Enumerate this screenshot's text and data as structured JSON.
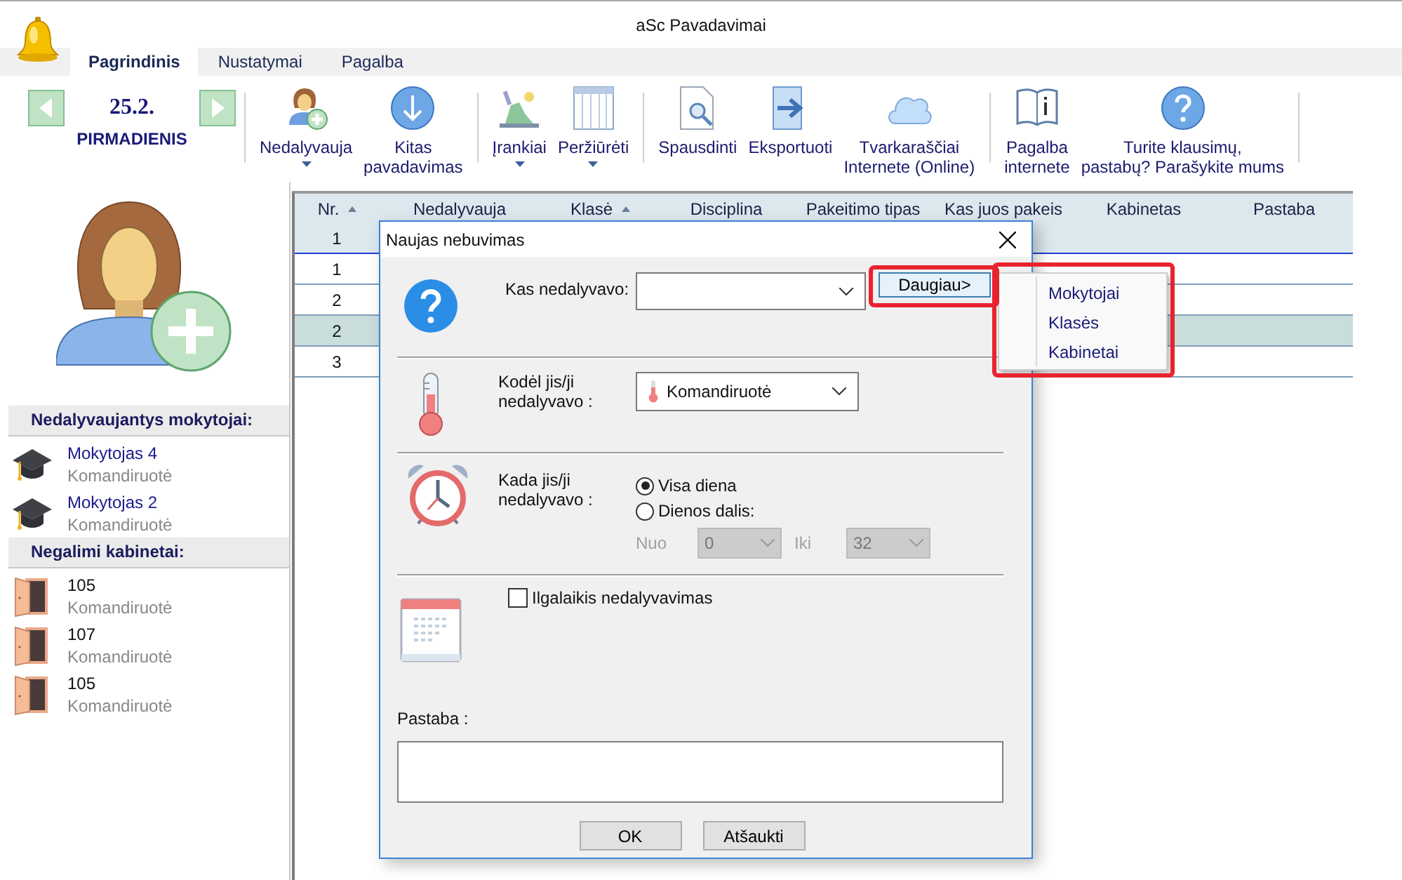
{
  "window": {
    "title": "aSc Pavadavimai"
  },
  "tabs": [
    {
      "label": "Pagrindinis",
      "selected": true
    },
    {
      "label": "Nustatymai",
      "selected": false
    },
    {
      "label": "Pagalba",
      "selected": false
    }
  ],
  "date": {
    "day": "25.2.",
    "weekday": "PIRMADIENIS"
  },
  "toolbar_groups": [
    [
      {
        "kind": "person-add",
        "label": "Nedalyvauja",
        "dropdown": true
      },
      {
        "kind": "arrow-down",
        "label": "Kitas\npavadavimas",
        "dropdown": false
      }
    ],
    [
      {
        "kind": "tools",
        "label": "Įrankiai",
        "dropdown": true
      },
      {
        "kind": "columns",
        "label": "Peržiūrėti",
        "dropdown": true
      }
    ],
    [
      {
        "kind": "print-preview",
        "label": "Spausdinti",
        "dropdown": false
      },
      {
        "kind": "export",
        "label": "Eksportuoti",
        "dropdown": false
      },
      {
        "kind": "cloud",
        "label": "Tvarkaraščiai\nInternete (Online)",
        "dropdown": false
      }
    ],
    [
      {
        "kind": "book",
        "label": "Pagalba\ninternete",
        "dropdown": false
      },
      {
        "kind": "question",
        "label": "Turite klausimų,\npastabų? Parašykite mums",
        "dropdown": false
      }
    ]
  ],
  "sidebar": [
    {
      "title": "Nedalyvaujantys mokytojai:",
      "kind": "teacher",
      "items": [
        {
          "name": "Mokytojas 4",
          "reason": "Komandiruotė"
        },
        {
          "name": "Mokytojas 2",
          "reason": "Komandiruotė"
        }
      ]
    },
    {
      "title": "Negalimi kabinetai:",
      "kind": "room",
      "items": [
        {
          "name": "105",
          "reason": "Komandiruotė"
        },
        {
          "name": "107",
          "reason": "Komandiruotė"
        },
        {
          "name": "105",
          "reason": "Komandiruotė"
        }
      ]
    }
  ],
  "table": {
    "columns": [
      {
        "label": "Nr.",
        "sorted": true
      },
      {
        "label": "Nedalyvauja",
        "sorted": false
      },
      {
        "label": "Klasė",
        "sorted": true
      },
      {
        "label": "Disciplina",
        "sorted": false
      },
      {
        "label": "Pakeitimo tipas",
        "sorted": false
      },
      {
        "label": "Kas juos pakeis",
        "sorted": false
      },
      {
        "label": "Kabinetas",
        "sorted": false
      },
      {
        "label": "Pastaba",
        "sorted": false
      }
    ],
    "rows": [
      {
        "nr": "1",
        "focused": true,
        "selected": false
      },
      {
        "nr": "1",
        "focused": false,
        "selected": false
      },
      {
        "nr": "2",
        "focused": false,
        "selected": false
      },
      {
        "nr": "2",
        "focused": false,
        "selected": true
      },
      {
        "nr": "3",
        "focused": false,
        "selected": false
      }
    ]
  },
  "dialog": {
    "title": "Naujas nebuvimas",
    "who": {
      "label": "Kas nedalyvavo:",
      "more_button": "Daugiau>"
    },
    "reason": {
      "label": "Kodėl jis/ji\nnedalyvavo :",
      "value": "Komandiruotė"
    },
    "when": {
      "label": "Kada jis/ji\nnedalyvavo :",
      "options": [
        {
          "label": "Visa diena",
          "selected": true
        },
        {
          "label": "Dienos dalis:",
          "selected": false
        }
      ],
      "from": {
        "label": "Nuo",
        "value": "0",
        "disabled": true
      },
      "to": {
        "label": "Iki",
        "value": "32",
        "disabled": true
      }
    },
    "long_term": {
      "label": "Ilgalaikis nedalyvavimas",
      "checked": false
    },
    "note": {
      "label": "Pastaba :"
    },
    "buttons": [
      "OK",
      "Atšaukti"
    ]
  },
  "more_menu": {
    "items": [
      "Mokytojai",
      "Klasės",
      "Kabinetai"
    ]
  }
}
